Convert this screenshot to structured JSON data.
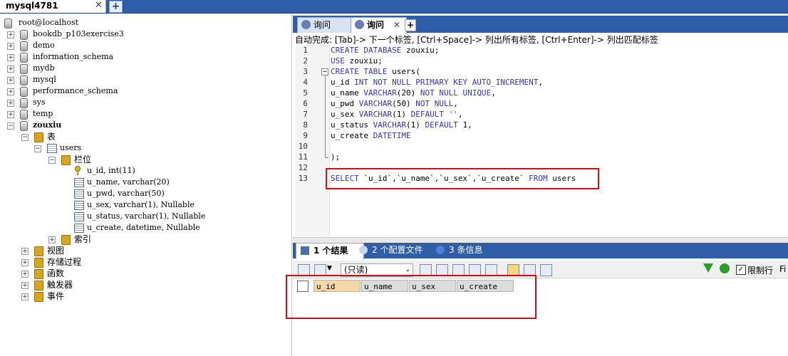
{
  "window": {
    "conn_tab": "mysql4781",
    "close_glyph": "✕",
    "add_glyph": "+"
  },
  "tree": {
    "root": "root@localhost",
    "databases": [
      "bookdb_p103exercise3",
      "demo",
      "information_schema",
      "mydb",
      "mysql",
      "performance_schema",
      "sys",
      "temp",
      "zouxiu"
    ],
    "tables_folder": "表",
    "table": "users",
    "columns_folder": "栏位",
    "columns": [
      "u_id, int(11)",
      "u_name, varchar(20)",
      "u_pwd, varchar(50)",
      "u_sex, varchar(1), Nullable",
      "u_status, varchar(1), Nullable",
      "u_create, datetime, Nullable"
    ],
    "index_folder": "索引",
    "other_folders": [
      "视图",
      "存储过程",
      "函数",
      "触发器",
      "事件"
    ]
  },
  "editor": {
    "tabs": [
      {
        "label": "询问"
      },
      {
        "label": "询问",
        "close": "✕"
      }
    ],
    "add_tab": "+",
    "autocomplete": "自动完成: [Tab]-> 下一个标签, [Ctrl+Space]-> 列出所有标签, [Ctrl+Enter]-> 列出匹配标签",
    "lines": [
      {
        "n": "1",
        "segs": [
          {
            "t": "CREATE DATABASE ",
            "c": "kw"
          },
          {
            "t": "zouxiu;",
            "c": ""
          }
        ]
      },
      {
        "n": "2",
        "segs": [
          {
            "t": "USE ",
            "c": "kw"
          },
          {
            "t": "zouxiu;",
            "c": ""
          }
        ]
      },
      {
        "n": "3",
        "segs": [
          {
            "t": "CREATE TABLE ",
            "c": "kw"
          },
          {
            "t": "users(",
            "c": ""
          }
        ]
      },
      {
        "n": "4",
        "segs": [
          {
            "t": "u_id ",
            "c": ""
          },
          {
            "t": "INT NOT NULL PRIMARY KEY AUTO_INCREMENT",
            "c": "kw"
          },
          {
            "t": ",",
            "c": ""
          }
        ]
      },
      {
        "n": "5",
        "segs": [
          {
            "t": "u_name ",
            "c": ""
          },
          {
            "t": "VARCHAR",
            "c": "kw"
          },
          {
            "t": "(20) ",
            "c": ""
          },
          {
            "t": "NOT NULL UNIQUE",
            "c": "kw"
          },
          {
            "t": ",",
            "c": ""
          }
        ]
      },
      {
        "n": "6",
        "segs": [
          {
            "t": "u_pwd ",
            "c": ""
          },
          {
            "t": "VARCHAR",
            "c": "kw"
          },
          {
            "t": "(50) ",
            "c": ""
          },
          {
            "t": "NOT NULL",
            "c": "kw"
          },
          {
            "t": ",",
            "c": ""
          }
        ]
      },
      {
        "n": "7",
        "segs": [
          {
            "t": "u_sex ",
            "c": ""
          },
          {
            "t": "VARCHAR",
            "c": "kw"
          },
          {
            "t": "(1) ",
            "c": ""
          },
          {
            "t": "DEFAULT ",
            "c": "kw"
          },
          {
            "t": "''",
            "c": "str"
          },
          {
            "t": ",",
            "c": ""
          }
        ]
      },
      {
        "n": "8",
        "segs": [
          {
            "t": "u_status ",
            "c": ""
          },
          {
            "t": "VARCHAR",
            "c": "kw"
          },
          {
            "t": "(1) ",
            "c": ""
          },
          {
            "t": "DEFAULT ",
            "c": "kw"
          },
          {
            "t": "1,",
            "c": ""
          }
        ]
      },
      {
        "n": "9",
        "segs": [
          {
            "t": "u_create ",
            "c": ""
          },
          {
            "t": "DATETIME",
            "c": "kw"
          }
        ]
      },
      {
        "n": "10",
        "segs": []
      },
      {
        "n": "11",
        "segs": [
          {
            "t": ");",
            "c": ""
          }
        ]
      },
      {
        "n": "12",
        "segs": []
      },
      {
        "n": "13",
        "segs": [
          {
            "t": "SELECT ",
            "c": "kw"
          },
          {
            "t": "`u_id`,`u_name`,`u_sex`,`u_create` ",
            "c": ""
          },
          {
            "t": "FROM ",
            "c": "kw"
          },
          {
            "t": "users",
            "c": ""
          }
        ]
      }
    ]
  },
  "results": {
    "tabs": [
      "1 个结果",
      "2 个配置文件",
      "3 条信息"
    ],
    "readonly": "(只读)",
    "limit_label": "限制行",
    "fi": "Fi",
    "columns": [
      "u_id",
      "u_name",
      "u_sex",
      "u_create"
    ]
  },
  "colors": {
    "accent": "#2f5da8",
    "highlight": "#d01010",
    "keyword": "#3434c0"
  }
}
